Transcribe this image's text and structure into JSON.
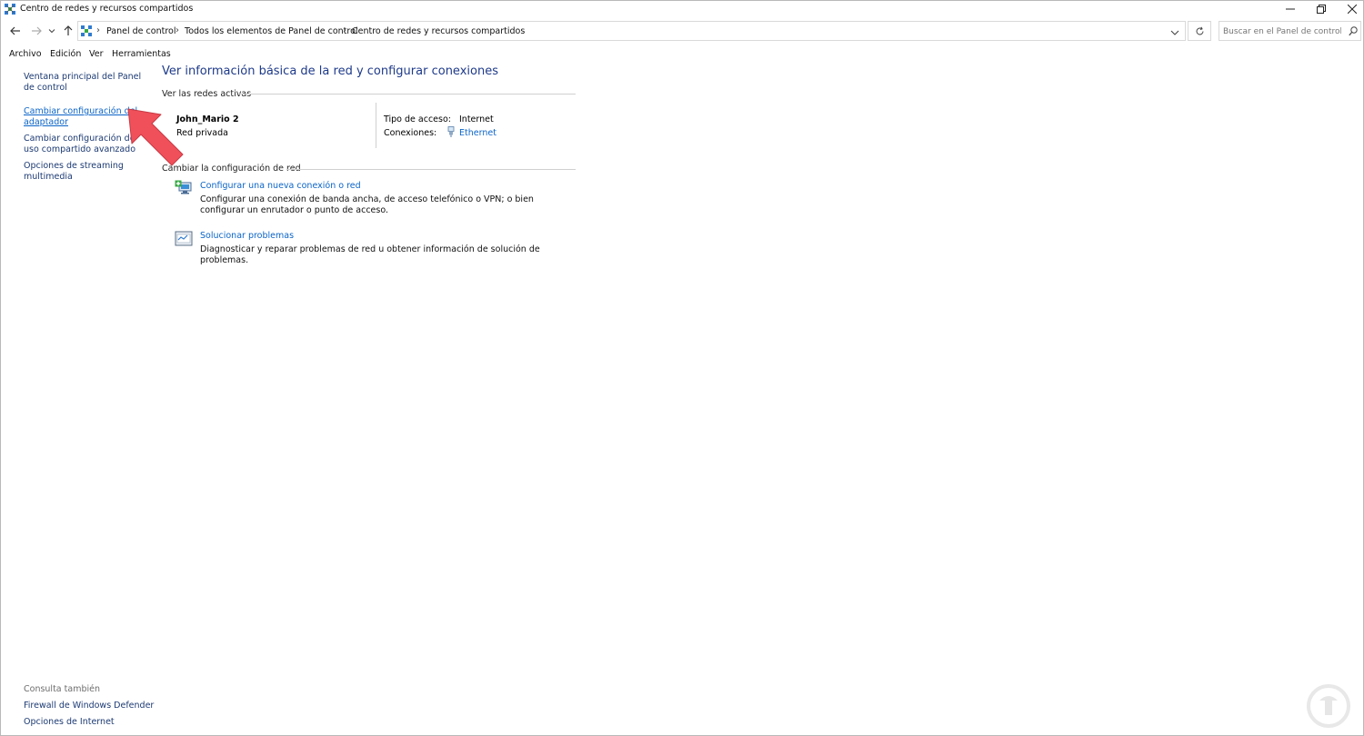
{
  "window": {
    "title": "Centro de redes y recursos compartidos"
  },
  "address_bar": {
    "crumbs": [
      "Panel de control",
      "Todos los elementos de Panel de control",
      "Centro de redes y recursos compartidos"
    ],
    "search_placeholder": "Buscar en el Panel de control"
  },
  "menu": [
    "Archivo",
    "Edición",
    "Ver",
    "Herramientas"
  ],
  "sidebar": {
    "items": [
      {
        "label": "Ventana principal del Panel de control"
      },
      {
        "label": "Cambiar configuración del adaptador"
      },
      {
        "label": "Cambiar configuración de uso compartido avanzado"
      },
      {
        "label": "Opciones de streaming multimedia"
      }
    ],
    "see_also_label": "Consulta también",
    "see_also": [
      "Firewall de Windows Defender",
      "Opciones de Internet"
    ]
  },
  "main": {
    "title": "Ver información básica de la red y configurar conexiones",
    "active_networks_label": "Ver las redes activas",
    "network": {
      "name": "John_Mario 2",
      "type": "Red privada",
      "access_type_label": "Tipo de acceso:",
      "access_type_value": "Internet",
      "connections_label": "Conexiones:",
      "connections_value": "Ethernet"
    },
    "change_settings_label": "Cambiar la configuración de red",
    "tasks": [
      {
        "title": "Configurar una nueva conexión o red",
        "desc": "Configurar una conexión de banda ancha, de acceso telefónico o VPN; o bien configurar un enrutador o punto de acceso."
      },
      {
        "title": "Solucionar problemas",
        "desc": "Diagnosticar y reparar problemas de red u obtener información de solución de problemas."
      }
    ]
  },
  "colors": {
    "link": "#0b64c8",
    "nav_link": "#1c3a73",
    "title": "#1e3a8a",
    "annotation_arrow": "#f0505a"
  },
  "icons": {
    "app": "network-center-icon",
    "back": "back-arrow-icon",
    "forward": "forward-arrow-icon",
    "recent": "chevron-down-icon",
    "up": "up-arrow-icon",
    "refresh": "refresh-icon",
    "search": "search-icon",
    "ethernet": "ethernet-icon"
  }
}
